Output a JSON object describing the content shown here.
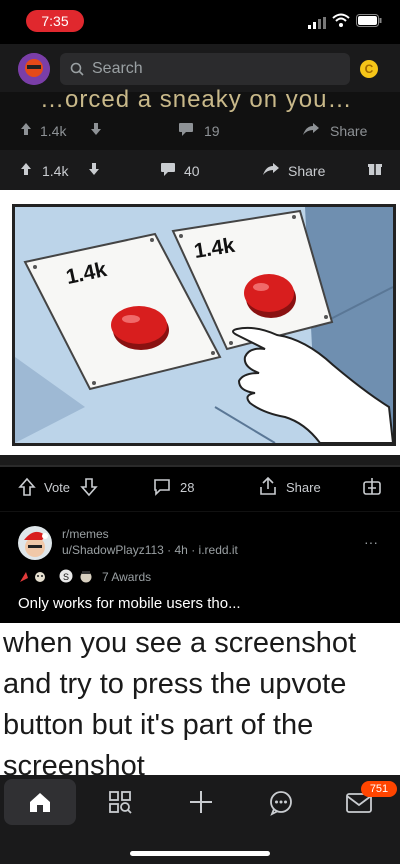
{
  "status_bar": {
    "time": "7:35"
  },
  "header": {
    "search_placeholder": "Search",
    "coin_symbol": "C"
  },
  "embedded_screenshot": {
    "cut_text": "…orced a sneaky on you…",
    "row1": {
      "votes": "1.4k",
      "comments": "19",
      "share": "Share"
    },
    "row2": {
      "votes": "1.4k",
      "comments": "40",
      "share": "Share"
    },
    "meme_buttons": [
      "1.4k",
      "1.4k"
    ]
  },
  "post": {
    "vote_label": "Vote",
    "comments": "28",
    "share_label": "Share",
    "subreddit": "r/memes",
    "byline": "u/ShadowPlayz113 · 4h · i.redd.it",
    "awards": "7 Awards",
    "title": "Only works for mobile users tho..."
  },
  "meme_caption": "when you see a screenshot and try to press the upvote button but it's part of the screenshot",
  "bottom_nav": {
    "inbox_badge": "751"
  },
  "colors": {
    "accent": "#ff4500",
    "time_pill": "#e0282e",
    "button_red": "#d81e1e"
  }
}
